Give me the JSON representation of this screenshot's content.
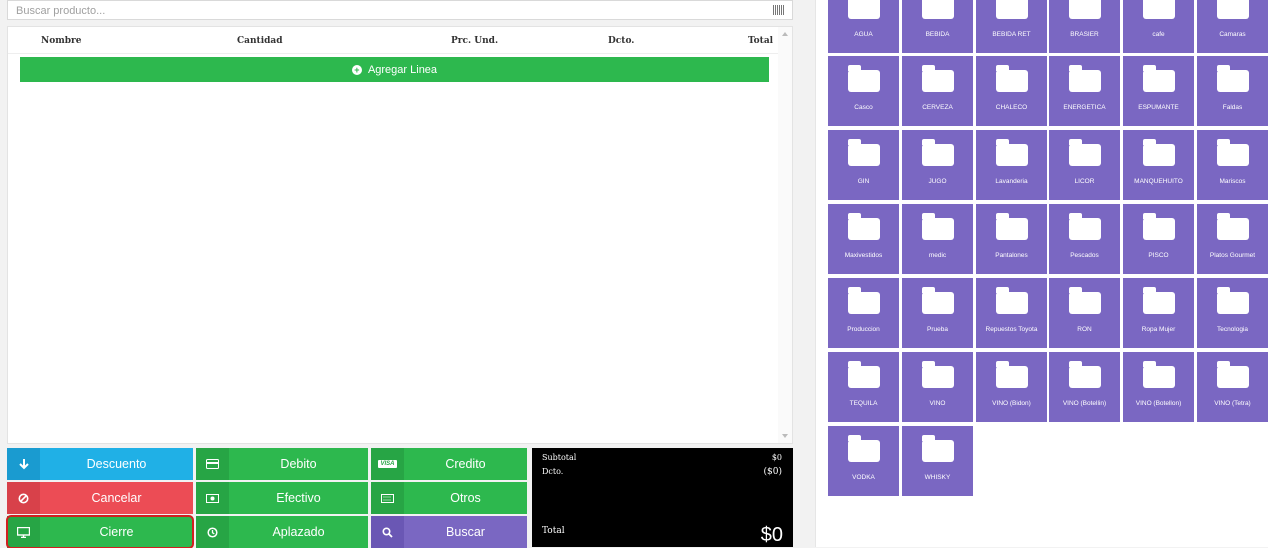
{
  "search": {
    "placeholder": "Buscar producto..."
  },
  "table": {
    "headers": [
      "Nombre",
      "Cantidad",
      "Prc. Und.",
      "Dcto.",
      "Total"
    ],
    "add_line_label": "Agregar Linea"
  },
  "buttons": {
    "descuento": "Descuento",
    "debito": "Debito",
    "credito": "Credito",
    "cancelar": "Cancelar",
    "efectivo": "Efectivo",
    "otros": "Otros",
    "cierre": "Cierre",
    "aplazado": "Aplazado",
    "buscar": "Buscar",
    "visa_icon_text": "VISA"
  },
  "totals": {
    "subtotal_label": "Subtotal",
    "subtotal_value": "$0",
    "dcto_label": "Dcto.",
    "dcto_value": "($0)",
    "total_label": "Total",
    "total_value": "$0"
  },
  "categories": [
    "AGUA",
    "BEBIDA",
    "BEBIDA RET",
    "BRASIER",
    "cafe",
    "Camaras",
    "Casco",
    "CERVEZA",
    "CHALECO",
    "ENERGETICA",
    "ESPUMANTE",
    "Faldas",
    "GIN",
    "JUGO",
    "Lavanderia",
    "LICOR",
    "MANQUEHUITO",
    "Mariscos",
    "Maxivestidos",
    "medic",
    "Pantalones",
    "Pescados",
    "PISCO",
    "Platos Gourmet",
    "Produccion",
    "Prueba",
    "Repuestos Toyota",
    "RON",
    "Ropa Mujer",
    "Tecnologia",
    "TEQUILA",
    "VINO",
    "VINO (Bidon)",
    "VINO (Botellin)",
    "VINO (Botellon)",
    "VINO (Tetra)",
    "VODKA",
    "WHISKY"
  ],
  "colors": {
    "tile": "#7a67c2",
    "green": "#2db84e",
    "red": "#ec4c55",
    "blue": "#20b0e6"
  }
}
